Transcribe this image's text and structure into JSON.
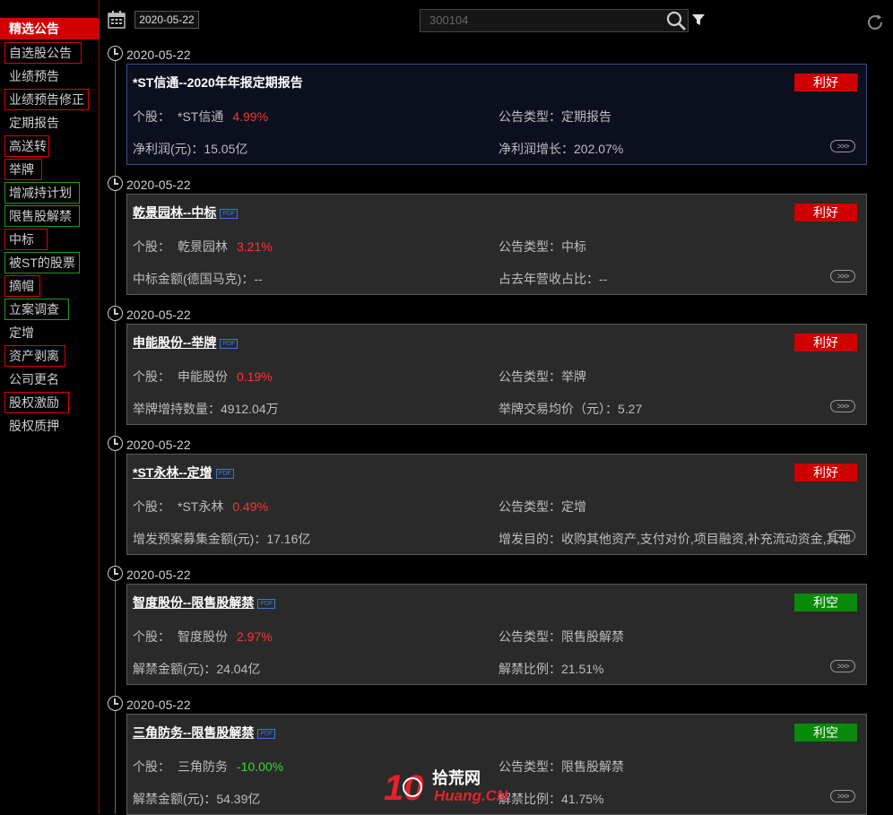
{
  "sidebar": {
    "active": "精选公告",
    "items": [
      {
        "label": "自选股公告",
        "box": "red"
      },
      {
        "label": "业绩预告",
        "box": ""
      },
      {
        "label": "业绩预告修正",
        "box": "red"
      },
      {
        "label": "定期报告",
        "box": ""
      },
      {
        "label": "高送转",
        "box": "red"
      },
      {
        "label": "举牌",
        "box": "red"
      },
      {
        "label": "增减持计划",
        "box": "green"
      },
      {
        "label": "限售股解禁",
        "box": "green"
      },
      {
        "label": "中标",
        "box": "red"
      },
      {
        "label": "被ST的股票",
        "box": "green"
      },
      {
        "label": "摘帽",
        "box": "red"
      },
      {
        "label": "立案调查",
        "box": "green"
      },
      {
        "label": "定增",
        "box": ""
      },
      {
        "label": "资产剥离",
        "box": "red"
      },
      {
        "label": "公司更名",
        "box": ""
      },
      {
        "label": "股权激励",
        "box": "red"
      },
      {
        "label": "股权质押",
        "box": ""
      }
    ]
  },
  "toolbar": {
    "date": "2020-05-22",
    "search_placeholder": "300104",
    "icons": [
      "calendar-icon",
      "search-icon",
      "filter-icon",
      "refresh-icon"
    ]
  },
  "cards": [
    {
      "date": "2020-05-22",
      "title": "*ST信通--2020年年报定期报告",
      "pdf": false,
      "badge": "利好",
      "badge_type": "good",
      "stock_label": "个股：",
      "stock": "*ST信通",
      "pct": "4.99%",
      "pct_dir": "up",
      "type_label": "公告类型：",
      "type": "定期报告",
      "extra1": "净利润(元)：15.05亿",
      "extra2": "净利润增长：202.07%"
    },
    {
      "date": "2020-05-22",
      "title": "乾景园林--中标",
      "pdf": true,
      "badge": "利好",
      "badge_type": "good",
      "stock_label": "个股：",
      "stock": "乾景园林",
      "pct": "3.21%",
      "pct_dir": "up",
      "type_label": "公告类型：",
      "type": "中标",
      "extra1": "中标金额(德国马克)：--",
      "extra2": "占去年营收占比：--"
    },
    {
      "date": "2020-05-22",
      "title": "申能股份--举牌",
      "pdf": true,
      "badge": "利好",
      "badge_type": "good",
      "stock_label": "个股：",
      "stock": "申能股份",
      "pct": "0.19%",
      "pct_dir": "up",
      "type_label": "公告类型：",
      "type": "举牌",
      "extra1": "举牌增持数量：4912.04万",
      "extra2": "举牌交易均价（元）：5.27"
    },
    {
      "date": "2020-05-22",
      "title": "*ST永林--定增",
      "pdf": true,
      "badge": "利好",
      "badge_type": "good",
      "stock_label": "个股：",
      "stock": "*ST永林",
      "pct": "0.49%",
      "pct_dir": "up",
      "type_label": "公告类型：",
      "type": "定增",
      "extra1": "增发预案募集金额(元)：17.16亿",
      "extra2": "增发目的：收购其他资产,支付对价,项目融资,补充流动资金,其他"
    },
    {
      "date": "2020-05-22",
      "title": "智度股份--限售股解禁",
      "pdf": true,
      "badge": "利空",
      "badge_type": "bad",
      "stock_label": "个股：",
      "stock": "智度股份",
      "pct": "2.97%",
      "pct_dir": "up",
      "type_label": "公告类型：",
      "type": "限售股解禁",
      "extra1": "解禁金额(元)：24.04亿",
      "extra2": "解禁比例：21.51%"
    },
    {
      "date": "2020-05-22",
      "title": "三角防务--限售股解禁",
      "pdf": true,
      "badge": "利空",
      "badge_type": "bad",
      "stock_label": "个股：",
      "stock": "三角防务",
      "pct": "-10.00%",
      "pct_dir": "down",
      "type_label": "公告类型：",
      "type": "限售股解禁",
      "extra1": "解禁金额(元)：54.39亿",
      "extra2": "解禁比例：41.75%"
    }
  ],
  "pdf_label": "PDF",
  "more_label": ">>>",
  "watermark": {
    "number": "10",
    "brand": "拾荒网",
    "domain": "Huang.CN"
  }
}
